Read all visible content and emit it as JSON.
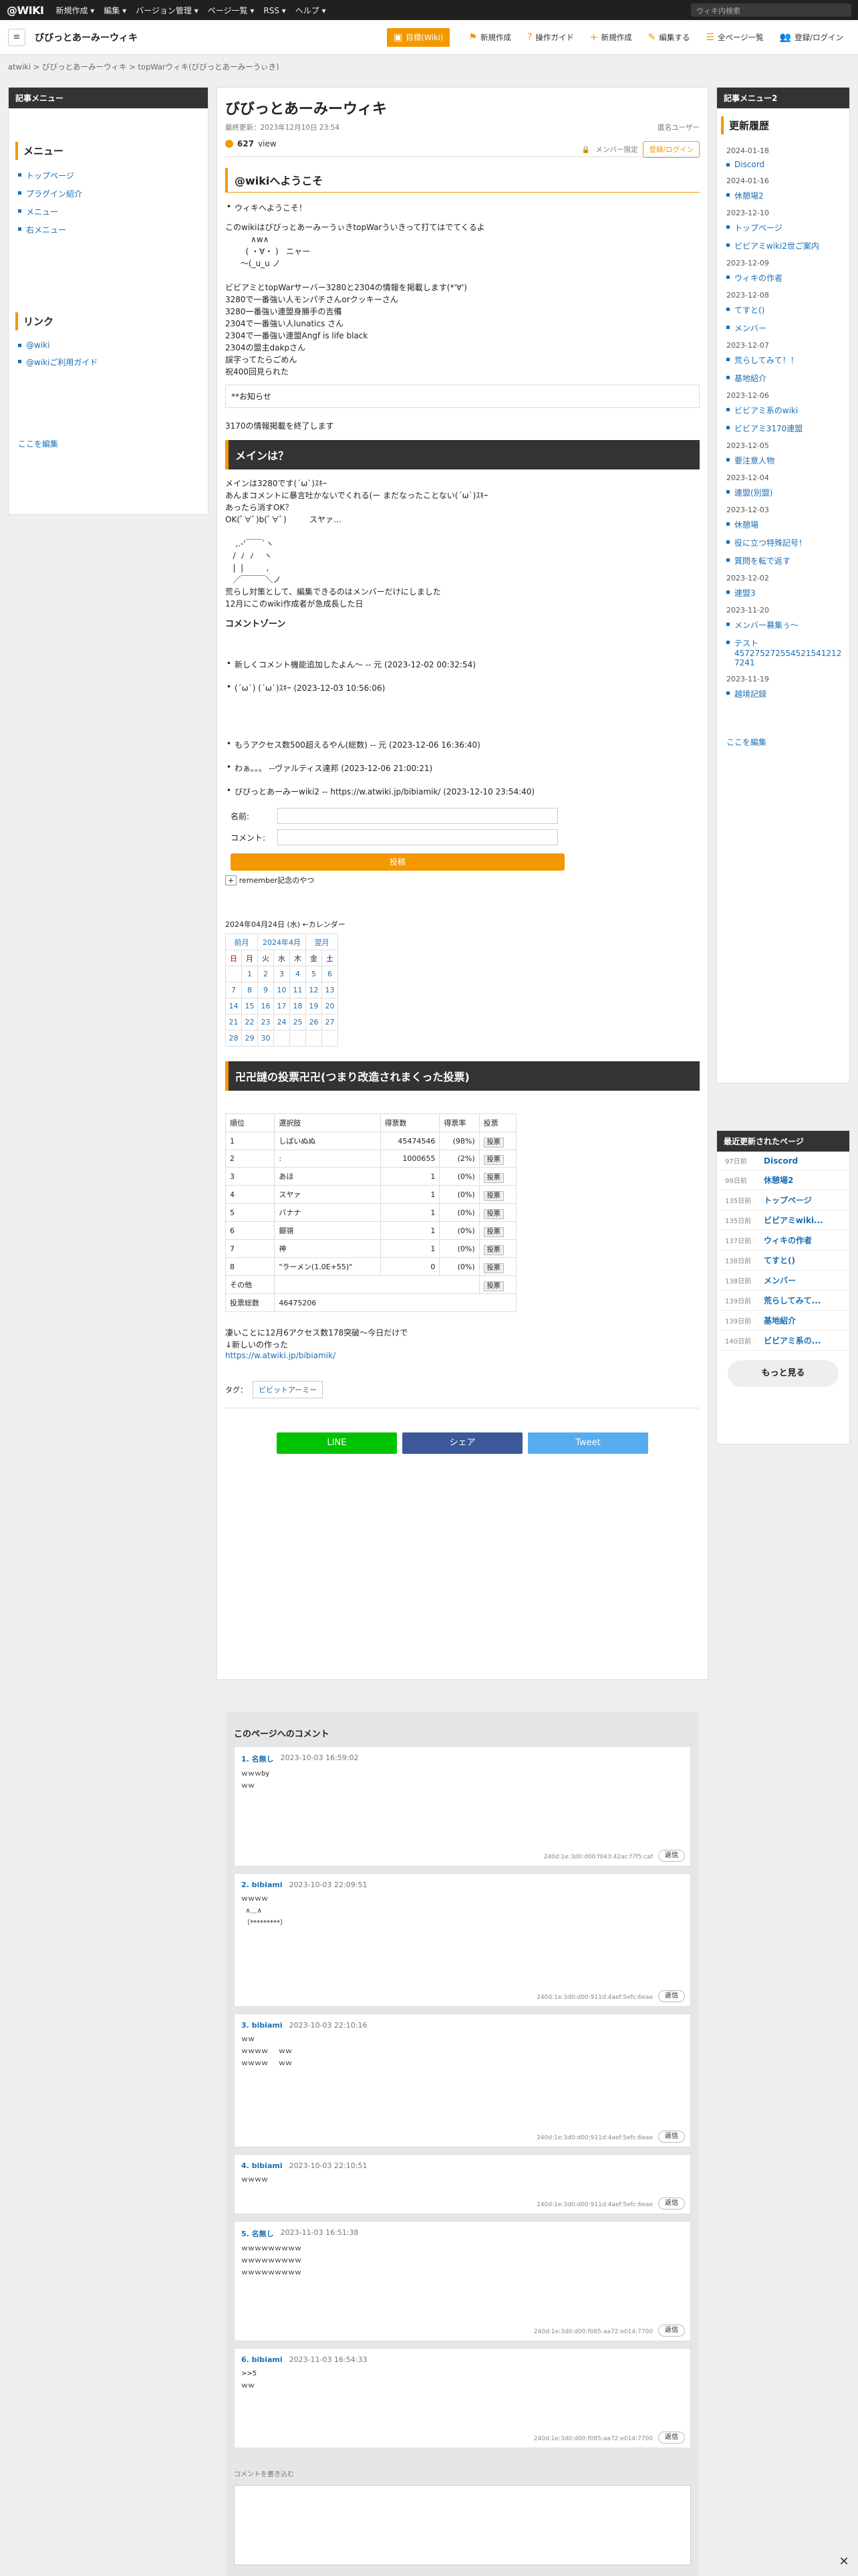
{
  "topbar": {
    "logo": "@WIKI",
    "menus": [
      "新規作成 ▾",
      "編集 ▾",
      "バージョン管理 ▾",
      "ページ一覧 ▾",
      "RSS ▾",
      "ヘルプ ▾"
    ],
    "search_placeholder": "ウィキ内検索"
  },
  "header": {
    "site_title": "びびっとあーみーウィキ",
    "tools": [
      "新規作成",
      "操作ガイド",
      "新規作成",
      "編集する",
      "全ページ一覧",
      "登録/ログイン"
    ],
    "primary_tool": "目標(Wiki)"
  },
  "breadcrumb": "atwiki > びびっとあーみーウィキ > topWarウィキ(びびっとあーみーうぃき)",
  "left": {
    "header": "記事メニュー",
    "menu_title": "メニュー",
    "menu": [
      "トップページ",
      "プラグイン紹介",
      "メニュー",
      "右メニュー"
    ],
    "links_title": "リンク",
    "links": [
      "@wiki",
      "@wikiご利用ガイド"
    ],
    "edit": "ここを編集"
  },
  "page": {
    "title": "びびっとあーみーウィキ",
    "updated": "最終更新：2023年12月10日 23:54",
    "author": "匿名ユーザー",
    "views": "627",
    "views_unit": "view",
    "member": "メンバー限定",
    "login": "登録/ログイン",
    "welcome_h": "@wikiへようこそ",
    "welcome_li": "ウィキへようこそ！",
    "intro": "このwikiはびびっとあーみーうぃきtopWarういきって打てはでてくるよ\n          ∧w∧\n        ( ・∀・ )   ニャー\n      〜(_u_u ノ\n\nビビアミとtopWarサーバー3280と2304の情報を掲載します(*'∀')\n3280で一番強い人モンパチさんorクッキーさん\n3280一番強い連盟身勝手の吉備\n2304で一番強い人lunatics さん\n2304で一番強い連盟Angf is life black\n2304の盟主dakpさん\n誤字ってたらごめん\n祝400回見られた",
    "notice": "**お知らせ",
    "notice2": "3170の情報掲載を終了します",
    "main_h": "メインは？",
    "main_txt": "メインは3280です(´ω`)ｽｷｰ\nあんまコメントに暴言吐かないでくれる(ー まだなったことない(´ω`)ｽｷｰ\nあったら消すOK？\nOK(ﾟ∀ﾟ)b(ﾟ∀ﾟ)         スヤァ…\n\n    ,.-'￣￣`ヽ\n   /  ﾉ  ﾉ    ヽ\n   |  |         ,\n   ／￣￣￣＼ノ\n荒らし対策として、編集できるのはメンバーだけにしました\n12月にこのwiki作成者が急成長した日",
    "comment_h": "コメントゾーン",
    "comments": [
      "新しくコメント機能追加したよん～ -- 元 (2023-12-02 00:32:54)",
      "(´ω`) (´ω`)ｽｷｰ (2023-12-03 10:56:06)",
      "もうアクセス数500超えるやん(総数) -- 元 (2023-12-06 16:36:40)",
      "わぁ。。。 --ヴァルティス達邦 (2023-12-06 21:00:21)",
      "びびっとあーみーwiki2 -- https://w.atwiki.jp/bibiamik/ (2023-12-10 23:54:40)"
    ],
    "name_label": "名前:",
    "comment_label": "コメント:",
    "post": "投稿",
    "remember": "remember記念のやつ",
    "cal_title": "2024年04月24日 (水) ←カレンダー",
    "cal_prev": "前月",
    "cal_month": "2024年4月",
    "cal_next": "翌月",
    "cal_days": [
      "日",
      "月",
      "火",
      "水",
      "木",
      "金",
      "土"
    ],
    "cal_rows": [
      [
        "",
        "1",
        "2",
        "3",
        "4",
        "5",
        "6"
      ],
      [
        "7",
        "8",
        "9",
        "10",
        "11",
        "12",
        "13"
      ],
      [
        "14",
        "15",
        "16",
        "17",
        "18",
        "19",
        "20"
      ],
      [
        "21",
        "22",
        "23",
        "24",
        "25",
        "26",
        "27"
      ],
      [
        "28",
        "29",
        "30",
        "",
        "",
        "",
        ""
      ]
    ],
    "vote_h": "卍卍謎の投票卍卍(つまり改造されまくった投票)",
    "vote_head": [
      "順位",
      "選択肢",
      "得票数",
      "得票率",
      "投票"
    ],
    "vote_rows": [
      [
        "1",
        "しばいぬぬ",
        "45474546",
        "(98%)"
      ],
      [
        "2",
        ":",
        "1000655",
        "(2%)"
      ],
      [
        "3",
        "あほ",
        "1",
        "(0%)"
      ],
      [
        "4",
        "スヤァ",
        "1",
        "(0%)"
      ],
      [
        "5",
        "バナナ",
        "1",
        "(0%)"
      ],
      [
        "6",
        "銀嶺",
        "1",
        "(0%)"
      ],
      [
        "7",
        "神",
        "1",
        "(0%)"
      ],
      [
        "8",
        "\"ラーメン(1.0E+55)\"",
        "0",
        "(0%)"
      ]
    ],
    "vote_btn": "投票",
    "vote_other": "その他",
    "vote_total_label": "投票総数",
    "vote_total": "46475206",
    "footer_txt": "凄いことに12月6アクセス数178突破〜今日だけで\n↓新しいの作った",
    "footer_link": "https://w.atwiki.jp/bibiamik/",
    "tag_label": "タグ：",
    "tag": "ビビットアーミー",
    "share": [
      "LINE",
      "シェア",
      "Tweet"
    ]
  },
  "right": {
    "header": "記事メニュー2",
    "hist_title": "更新履歴",
    "history": [
      [
        "2024-01-18",
        [
          "Discord"
        ]
      ],
      [
        "2024-01-16",
        [
          "休憩場2"
        ]
      ],
      [
        "2023-12-10",
        [
          "トップページ",
          "ビビアミwiki2世ご案内"
        ]
      ],
      [
        "2023-12-09",
        [
          "ウィキの作者"
        ]
      ],
      [
        "2023-12-08",
        [
          "てすと()",
          "メンバー"
        ]
      ],
      [
        "2023-12-07",
        [
          "荒らしてみて！！",
          "基地紹介"
        ]
      ],
      [
        "2023-12-06",
        [
          "ビビアミ系のwiki",
          "ビビアミ3170連盟"
        ]
      ],
      [
        "2023-12-05",
        [
          "要注意人物"
        ]
      ],
      [
        "2023-12-04",
        [
          "連盟(別盟)"
        ]
      ],
      [
        "2023-12-03",
        [
          "休憩場",
          "役に立つ特殊記号！",
          "質問を転で返す"
        ]
      ],
      [
        "2023-12-02",
        [
          "連盟3"
        ]
      ],
      [
        "2023-11-20",
        [
          "メンバー募集ぅ～",
          "テスト457275272554521541212 7241"
        ]
      ],
      [
        "2023-11-19",
        [
          "越境記録"
        ]
      ]
    ],
    "edit": "ここを編集",
    "recent_header": "最近更新されたページ",
    "recent": [
      [
        "97日前",
        "Discord"
      ],
      [
        "99日前",
        "休憩場2"
      ],
      [
        "135日前",
        "トップページ"
      ],
      [
        "135日前",
        "ビビアミwiki..."
      ],
      [
        "137日前",
        "ウィキの作者"
      ],
      [
        "138日前",
        "てすと()"
      ],
      [
        "138日前",
        "メンバー"
      ],
      [
        "139日前",
        "荒らしてみて..."
      ],
      [
        "139日前",
        "基地紹介"
      ],
      [
        "140日前",
        "ビビアミ系の..."
      ]
    ],
    "more": "もっと見る"
  },
  "comments_section": {
    "title": "このページへのコメント",
    "items": [
      [
        "1",
        "名無し",
        "2023-10-03 16:59:02",
        "ｗｗｗby\nｗｗ",
        "240d:1e:3d0:d00:f043:42ac:f7f5:caf"
      ],
      [
        "2",
        "bibiami",
        "2023-10-03 22:09:51",
        "ｗｗｗｗ\n  ∧＿∧\n （*********）",
        "240d:1e:3d0:d00:911d:4aef:5efc:6eae"
      ],
      [
        "3",
        "bibiami",
        "2023-10-03 22:10:16",
        "ｗｗ\nｗｗｗｗ     ｗｗ\nｗｗｗｗ     ｗｗ",
        "240d:1e:3d0:d00:911d:4aef:5efc:6eae"
      ],
      [
        "4",
        "bibiami",
        "2023-10-03 22:10:51",
        "ｗｗｗｗ",
        "240d:1e:3d0:d00:911d:4aef:5efc:6eae"
      ],
      [
        "5",
        "名無し",
        "2023-11-03 16:51:38",
        "ｗｗｗｗｗｗｗｗｗ\nｗｗｗｗｗｗｗｗｗ\nｗｗｗｗｗｗｗｗｗ",
        "240d:1e:3d0:d00:f085:aa72:e014:7700"
      ],
      [
        "6",
        "bibiami",
        "2023-11-03 16:54:33",
        ">>5\nｗｗ",
        "240d:1e:3d0:d00:f085:aa72:e014:7700"
      ]
    ],
    "reply": "返信",
    "new_label": "コメントを書き込む"
  }
}
